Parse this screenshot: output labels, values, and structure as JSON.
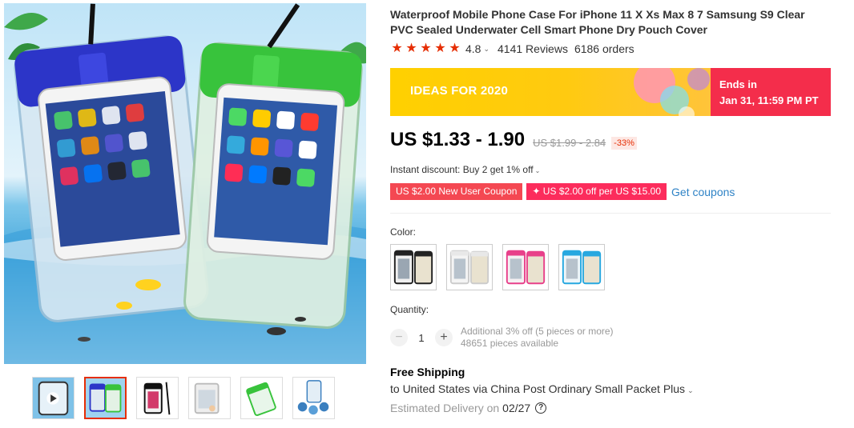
{
  "product": {
    "title": "Waterproof Mobile Phone Case For iPhone 11 X Xs Max 8 7 Samsung S9 Clear PVC Sealed Underwater Cell Smart Phone Dry Pouch Cover",
    "rating": "4.8",
    "rating_stars": 5,
    "reviews": "4141 Reviews",
    "orders": "6186 orders"
  },
  "gallery": {
    "main_image": "two-waterproof-phone-pouches-blue-green-in-water",
    "thumbnails": [
      "video-preview",
      "blue-green-pouches",
      "black-pouch-lanyard",
      "white-pouch-detail",
      "green-pouch-size",
      "pouch-features"
    ],
    "active_thumbnail": 1
  },
  "promo_banner": {
    "text": "IDEAS FOR 2020",
    "ends_label": "Ends in",
    "ends_time": "Jan 31, 11:59 PM PT",
    "colors": {
      "left": "#ffd000",
      "right": "#f42d4b"
    }
  },
  "pricing": {
    "price": "US $1.33 - 1.90",
    "original_price": "US $1.99 - 2.84",
    "discount": "-33%",
    "instant_discount": "Instant discount: Buy 2 get 1% off"
  },
  "coupons": {
    "new_user": "US $2.00 New User Coupon",
    "store": "✦ US $2.00 off per US $15.00",
    "get_link": "Get coupons"
  },
  "color": {
    "label": "Color:",
    "options": [
      {
        "name": "black",
        "accent": "#222222"
      },
      {
        "name": "white",
        "accent": "#e8e8e8"
      },
      {
        "name": "pink",
        "accent": "#e8408a"
      },
      {
        "name": "blue",
        "accent": "#27a8e0"
      }
    ]
  },
  "quantity": {
    "label": "Quantity:",
    "value": "1",
    "minus": "−",
    "plus": "+",
    "promo": "Additional 3% off (5 pieces or more)",
    "available": "48651 pieces available"
  },
  "shipping": {
    "title": "Free Shipping",
    "destination": "to United States via China Post Ordinary Small Packet Plus",
    "delivery_label": "Estimated Delivery on",
    "delivery_date": "02/27",
    "help": "?"
  },
  "colors": {
    "accent_red": "#e62e04",
    "link_blue": "#2f83c6"
  }
}
